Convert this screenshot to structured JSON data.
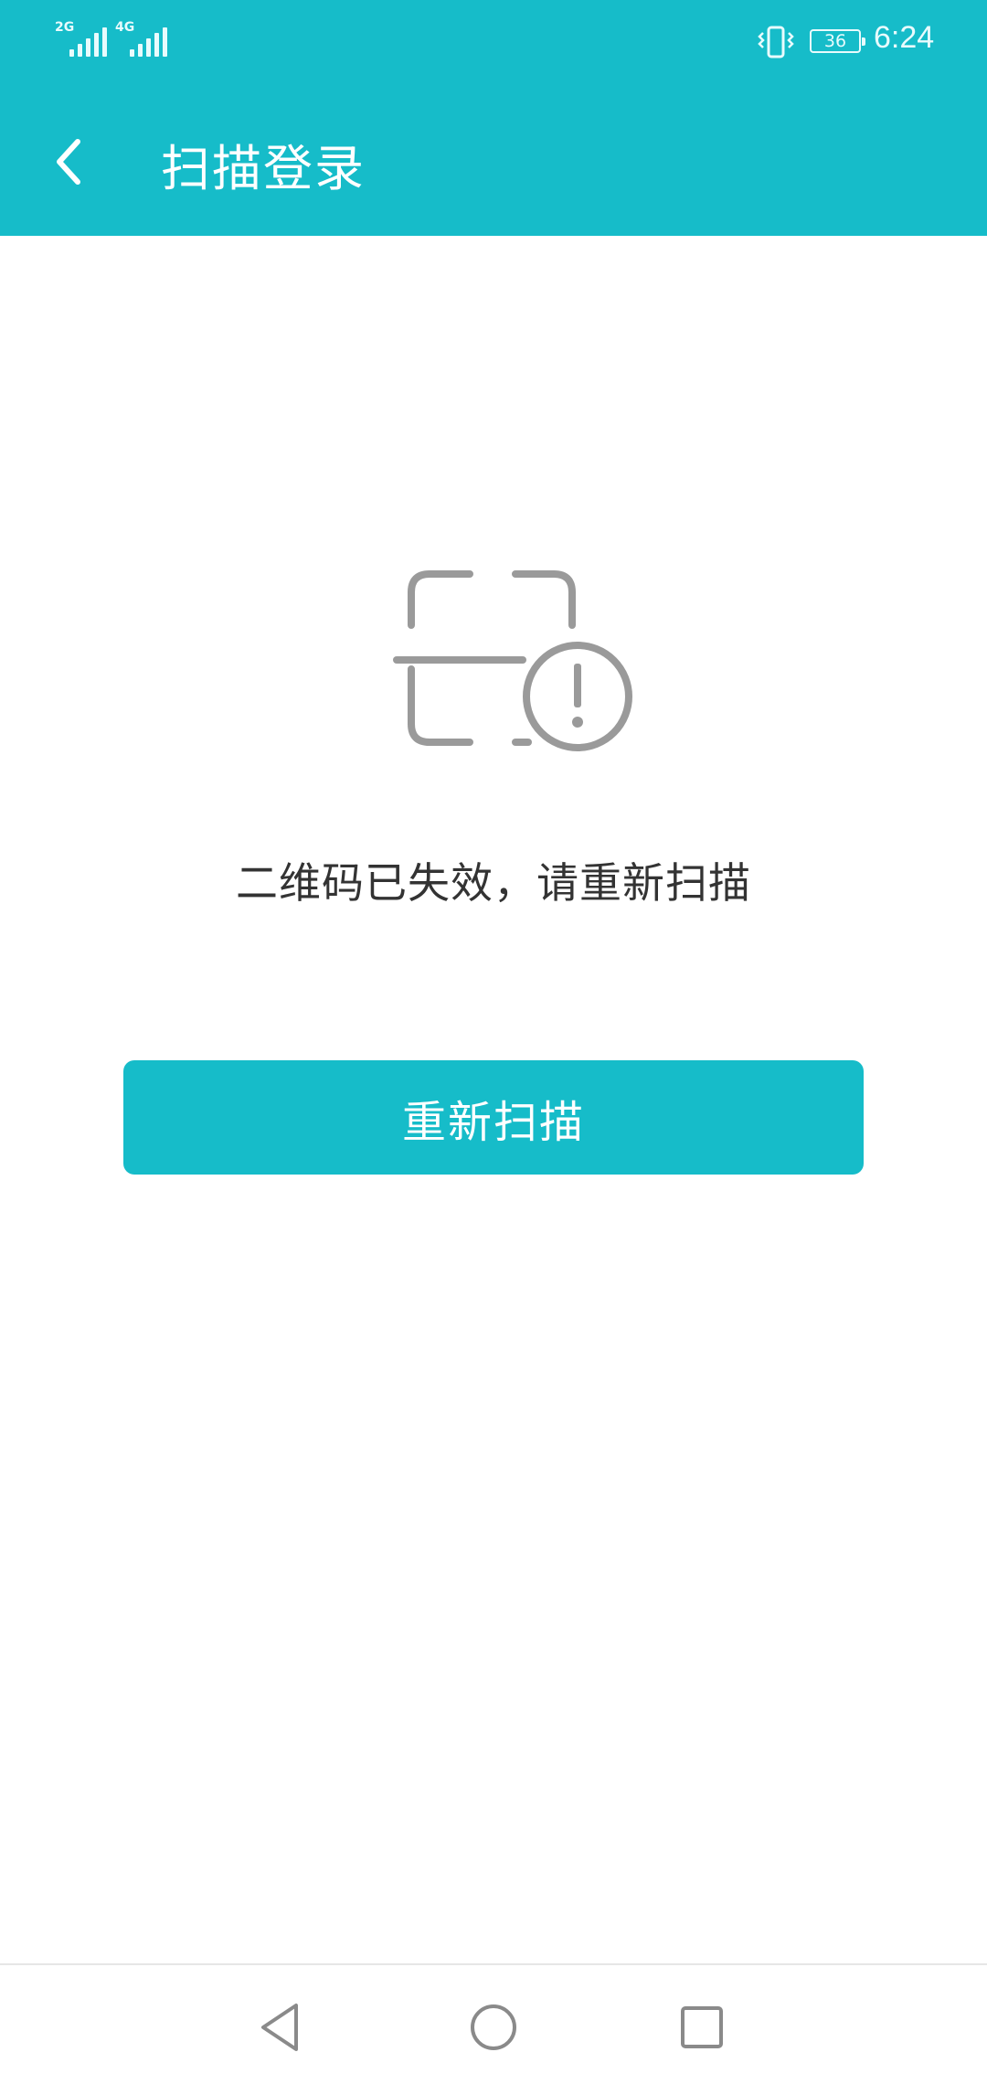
{
  "status_bar": {
    "signal1_label": "2G",
    "signal2_label": "4G",
    "battery_level": "36",
    "time": "6:24"
  },
  "header": {
    "title": "扫描登录",
    "back_icon": "chevron-left-icon",
    "background_color": "#16bcc9"
  },
  "main": {
    "icon": "qr-scan-expired-icon",
    "message": "二维码已失效，请重新扫描",
    "rescan_label": "重新扫描",
    "button_color": "#16bcc9"
  },
  "nav_bar": {
    "back_icon": "triangle-back-icon",
    "home_icon": "circle-home-icon",
    "recent_icon": "square-recent-icon"
  }
}
